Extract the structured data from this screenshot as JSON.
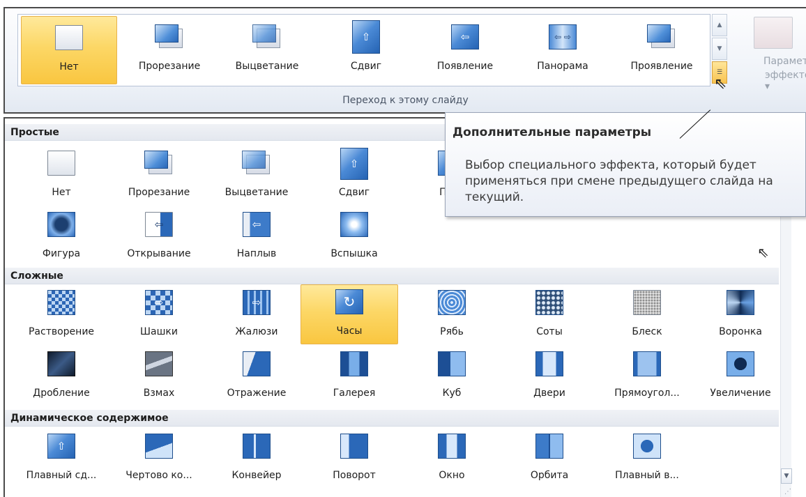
{
  "ribbon": {
    "items": [
      {
        "label": "Нет",
        "icon": "none-transition-icon",
        "selected": true
      },
      {
        "label": "Прорезание",
        "icon": "cut-transition-icon"
      },
      {
        "label": "Выцветание",
        "icon": "fade-transition-icon"
      },
      {
        "label": "Сдвиг",
        "icon": "push-transition-icon"
      },
      {
        "label": "Появление",
        "icon": "wipe-transition-icon"
      },
      {
        "label": "Панорама",
        "icon": "split-transition-icon"
      },
      {
        "label": "Проявление",
        "icon": "reveal-transition-icon"
      }
    ],
    "group_label": "Переход к этому слайду",
    "effects_button": {
      "line1": "Параметры",
      "line2": "эффектов ▾"
    },
    "scroll_up": "▲",
    "scroll_down": "▼",
    "more_button": "☰"
  },
  "tooltip": {
    "title": "Дополнительные параметры",
    "body": "Выбор специального эффекта, который будет применяться при смене предыдущего слайда на текущий."
  },
  "gallery": {
    "sections": [
      {
        "title": "Простые",
        "rows": [
          [
            {
              "label": "Нет",
              "icon": "none-transition-icon"
            },
            {
              "label": "Прорезание",
              "icon": "cut-transition-icon"
            },
            {
              "label": "Выцветание",
              "icon": "fade-transition-icon"
            },
            {
              "label": "Сдвиг",
              "icon": "push-transition-icon"
            },
            {
              "label": "Появ",
              "icon": "wipe-transition-icon"
            }
          ],
          [
            {
              "label": "Фигура",
              "icon": "shape-transition-icon"
            },
            {
              "label": "Открывание",
              "icon": "uncover-transition-icon"
            },
            {
              "label": "Наплыв",
              "icon": "cover-transition-icon"
            },
            {
              "label": "Вспышка",
              "icon": "flash-transition-icon"
            }
          ]
        ]
      },
      {
        "title": "Сложные",
        "rows": [
          [
            {
              "label": "Растворение",
              "icon": "dissolve-transition-icon"
            },
            {
              "label": "Шашки",
              "icon": "checkerboard-transition-icon"
            },
            {
              "label": "Жалюзи",
              "icon": "blinds-transition-icon"
            },
            {
              "label": "Часы",
              "icon": "clock-transition-icon",
              "selected": true
            },
            {
              "label": "Рябь",
              "icon": "ripple-transition-icon"
            },
            {
              "label": "Соты",
              "icon": "honeycomb-transition-icon"
            },
            {
              "label": "Блеск",
              "icon": "glitter-transition-icon"
            },
            {
              "label": "Воронка",
              "icon": "vortex-transition-icon"
            }
          ],
          [
            {
              "label": "Дробление",
              "icon": "shred-transition-icon"
            },
            {
              "label": "Взмах",
              "icon": "switch-transition-icon"
            },
            {
              "label": "Отражение",
              "icon": "flip-transition-icon"
            },
            {
              "label": "Галерея",
              "icon": "gallery-transition-icon"
            },
            {
              "label": "Куб",
              "icon": "cube-transition-icon"
            },
            {
              "label": "Двери",
              "icon": "doors-transition-icon"
            },
            {
              "label": "Прямоугол...",
              "icon": "box-transition-icon"
            },
            {
              "label": "Увеличение",
              "icon": "zoom-transition-icon"
            }
          ]
        ]
      },
      {
        "title": "Динамическое содержимое",
        "rows": [
          [
            {
              "label": "Плавный сд...",
              "icon": "pan-transition-icon"
            },
            {
              "label": "Чертово ко...",
              "icon": "ferris-wheel-transition-icon"
            },
            {
              "label": "Конвейер",
              "icon": "conveyor-transition-icon"
            },
            {
              "label": "Поворот",
              "icon": "rotate-transition-icon"
            },
            {
              "label": "Окно",
              "icon": "window-transition-icon"
            },
            {
              "label": "Орбита",
              "icon": "orbit-transition-icon"
            },
            {
              "label": "Плавный в...",
              "icon": "fly-through-transition-icon"
            }
          ]
        ]
      }
    ],
    "scroll_down": "▼",
    "resize_grip": "⋰"
  }
}
